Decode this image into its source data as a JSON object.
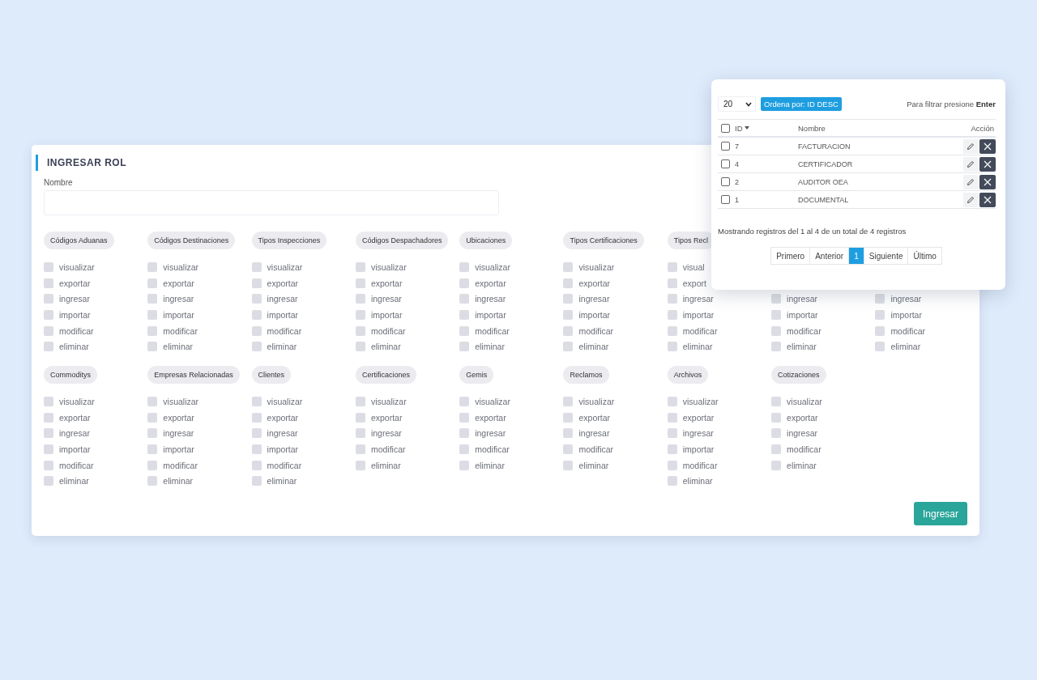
{
  "form": {
    "title": "INGRESAR ROL",
    "name_label": "Nombre",
    "group_rows": [
      [
        {
          "title": "Códigos Aduanas",
          "options": [
            {
              "label": "visualizar",
              "checked": false
            },
            {
              "label": "exportar",
              "checked": false
            },
            {
              "label": "ingresar",
              "checked": false
            },
            {
              "label": "importar",
              "checked": false
            },
            {
              "label": "modificar",
              "checked": false
            },
            {
              "label": "eliminar",
              "checked": false
            }
          ]
        },
        {
          "title": "Códigos Destinaciones",
          "options": [
            {
              "label": "visualizar",
              "checked": false
            },
            {
              "label": "exportar",
              "checked": false
            },
            {
              "label": "ingresar",
              "checked": false
            },
            {
              "label": "importar",
              "checked": false
            },
            {
              "label": "modificar",
              "checked": false
            },
            {
              "label": "eliminar",
              "checked": false
            }
          ]
        },
        {
          "title": "Tipos Inspecciones",
          "options": [
            {
              "label": "visualizar",
              "checked": false
            },
            {
              "label": "exportar",
              "checked": false
            },
            {
              "label": "ingresar",
              "checked": false
            },
            {
              "label": "importar",
              "checked": false
            },
            {
              "label": "modificar",
              "checked": false
            },
            {
              "label": "eliminar",
              "checked": false
            }
          ]
        },
        {
          "title": "Códigos Despachadores",
          "options": [
            {
              "label": "visualizar",
              "checked": false
            },
            {
              "label": "exportar",
              "checked": false
            },
            {
              "label": "ingresar",
              "checked": false
            },
            {
              "label": "importar",
              "checked": false
            },
            {
              "label": "modificar",
              "checked": false
            },
            {
              "label": "eliminar",
              "checked": false
            }
          ]
        },
        {
          "title": "Ubicaciones",
          "options": [
            {
              "label": "visualizar",
              "checked": false
            },
            {
              "label": "exportar",
              "checked": false
            },
            {
              "label": "ingresar",
              "checked": false
            },
            {
              "label": "importar",
              "checked": false
            },
            {
              "label": "modificar",
              "checked": false
            },
            {
              "label": "eliminar",
              "checked": false
            }
          ]
        },
        {
          "title": "Tipos Certificaciones",
          "options": [
            {
              "label": "visualizar",
              "checked": false
            },
            {
              "label": "exportar",
              "checked": false
            },
            {
              "label": "ingresar",
              "checked": false
            },
            {
              "label": "importar",
              "checked": false
            },
            {
              "label": "modificar",
              "checked": false
            },
            {
              "label": "eliminar",
              "checked": false
            }
          ]
        },
        {
          "title": "Tipos Recl",
          "options": [
            {
              "label": "visual",
              "checked": false
            },
            {
              "label": "export",
              "checked": false
            },
            {
              "label": "ingresar",
              "checked": false
            },
            {
              "label": "importar",
              "checked": false
            },
            {
              "label": "modificar",
              "checked": false
            },
            {
              "label": "eliminar",
              "checked": false
            }
          ]
        },
        {
          "options": [
            {
              "label": "ingresar",
              "checked": false
            },
            {
              "label": "importar",
              "checked": false
            },
            {
              "label": "modificar",
              "checked": false
            },
            {
              "label": "eliminar",
              "checked": false
            }
          ]
        },
        {
          "options": [
            {
              "label": "ingresar",
              "checked": false
            },
            {
              "label": "importar",
              "checked": false
            },
            {
              "label": "modificar",
              "checked": false
            },
            {
              "label": "eliminar",
              "checked": false
            }
          ]
        }
      ],
      [
        {
          "title": "Commoditys",
          "options": [
            {
              "label": "visualizar",
              "checked": false
            },
            {
              "label": "exportar",
              "checked": false
            },
            {
              "label": "ingresar",
              "checked": false
            },
            {
              "label": "importar",
              "checked": false
            },
            {
              "label": "modificar",
              "checked": false
            },
            {
              "label": "eliminar",
              "checked": false
            }
          ]
        },
        {
          "title": "Empresas Relacionadas",
          "options": [
            {
              "label": "visualizar",
              "checked": false
            },
            {
              "label": "exportar",
              "checked": false
            },
            {
              "label": "ingresar",
              "checked": false
            },
            {
              "label": "importar",
              "checked": false
            },
            {
              "label": "modificar",
              "checked": false
            },
            {
              "label": "eliminar",
              "checked": false
            }
          ]
        },
        {
          "title": "Clientes",
          "options": [
            {
              "label": "visualizar",
              "checked": false
            },
            {
              "label": "exportar",
              "checked": false
            },
            {
              "label": "ingresar",
              "checked": false
            },
            {
              "label": "importar",
              "checked": false
            },
            {
              "label": "modificar",
              "checked": false
            },
            {
              "label": "eliminar",
              "checked": false
            }
          ]
        },
        {
          "title": "Certificaciones",
          "options": [
            {
              "label": "visualizar",
              "checked": false
            },
            {
              "label": "exportar",
              "checked": false
            },
            {
              "label": "ingresar",
              "checked": false
            },
            {
              "label": "modificar",
              "checked": false
            },
            {
              "label": "eliminar",
              "checked": false
            }
          ]
        },
        {
          "title": "Gemis",
          "options": [
            {
              "label": "visualizar",
              "checked": false
            },
            {
              "label": "exportar",
              "checked": false
            },
            {
              "label": "ingresar",
              "checked": false
            },
            {
              "label": "modificar",
              "checked": false
            },
            {
              "label": "eliminar",
              "checked": false
            }
          ]
        },
        {
          "title": "Reclamos",
          "options": [
            {
              "label": "visualizar",
              "checked": false
            },
            {
              "label": "exportar",
              "checked": false
            },
            {
              "label": "ingresar",
              "checked": false
            },
            {
              "label": "modificar",
              "checked": false
            },
            {
              "label": "eliminar",
              "checked": false
            }
          ]
        },
        {
          "title": "Archivos",
          "options": [
            {
              "label": "visualizar",
              "checked": false
            },
            {
              "label": "exportar",
              "checked": false
            },
            {
              "label": "ingresar",
              "checked": false
            },
            {
              "label": "importar",
              "checked": false
            },
            {
              "label": "modificar",
              "checked": false
            },
            {
              "label": "eliminar",
              "checked": false
            }
          ]
        },
        {
          "title": "Cotizaciones",
          "options": [
            {
              "label": "visualizar",
              "checked": false
            },
            {
              "label": "exportar",
              "checked": false
            },
            {
              "label": "ingresar",
              "checked": false
            },
            {
              "label": "modificar",
              "checked": false
            },
            {
              "label": "eliminar",
              "checked": false
            }
          ]
        }
      ]
    ],
    "submit": "Ingresar"
  },
  "list_panel": {
    "page_size": "20",
    "sort_badge": "Ordena por: ID DESC",
    "filter_hint": "Para filtrar presione **Enter**",
    "select_all_checked": false,
    "columns": [
      "ID",
      "Nombre",
      "Acción"
    ],
    "rows": [
      {
        "id": "7",
        "name": "FACTURACION",
        "checked": false
      },
      {
        "id": "4",
        "name": "CERTIFICADOR",
        "checked": false
      },
      {
        "id": "2",
        "name": "AUDITOR OEA",
        "checked": false
      },
      {
        "id": "1",
        "name": "DOCUMENTAL",
        "checked": false
      }
    ],
    "summary": "Mostrando registros del 1 al 4 de un total de 4 registros",
    "pagination": [
      {
        "label": "Primero",
        "selected": false
      },
      {
        "label": "Anterior",
        "selected": false
      },
      {
        "label": "1",
        "selected": true
      },
      {
        "label": "Siguiente",
        "selected": false
      },
      {
        "label": "Último",
        "selected": false
      }
    ]
  }
}
